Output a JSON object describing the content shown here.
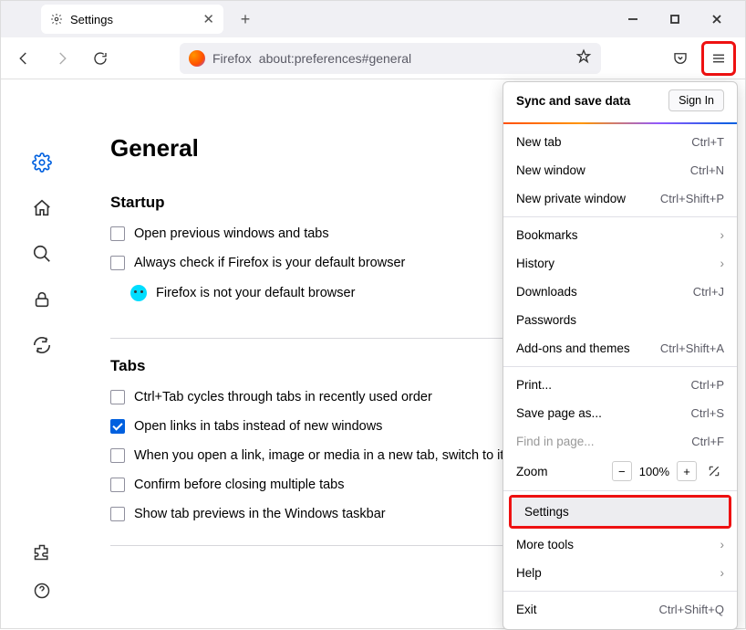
{
  "tab": {
    "title": "Settings"
  },
  "urlbar": {
    "name": "Firefox",
    "path": "about:preferences#general"
  },
  "page": {
    "heading": "General",
    "startup": {
      "title": "Startup",
      "open_previous": "Open previous windows and tabs",
      "always_check": "Always check if Firefox is your default browser",
      "not_default": "Firefox is not your default browser"
    },
    "tabs": {
      "title": "Tabs",
      "ctrl_tab": "Ctrl+Tab cycles through tabs in recently used order",
      "open_links": "Open links in tabs instead of new windows",
      "switch_new": "When you open a link, image or media in a new tab, switch to it immediately",
      "confirm_close": "Confirm before closing multiple tabs",
      "show_previews": "Show tab previews in the Windows taskbar"
    }
  },
  "menu": {
    "sync_header": "Sync and save data",
    "sign_in": "Sign In",
    "new_tab": {
      "label": "New tab",
      "shortcut": "Ctrl+T"
    },
    "new_window": {
      "label": "New window",
      "shortcut": "Ctrl+N"
    },
    "new_private": {
      "label": "New private window",
      "shortcut": "Ctrl+Shift+P"
    },
    "bookmarks": {
      "label": "Bookmarks"
    },
    "history": {
      "label": "History"
    },
    "downloads": {
      "label": "Downloads",
      "shortcut": "Ctrl+J"
    },
    "passwords": {
      "label": "Passwords"
    },
    "addons": {
      "label": "Add-ons and themes",
      "shortcut": "Ctrl+Shift+A"
    },
    "print": {
      "label": "Print...",
      "shortcut": "Ctrl+P"
    },
    "save_as": {
      "label": "Save page as...",
      "shortcut": "Ctrl+S"
    },
    "find": {
      "label": "Find in page...",
      "shortcut": "Ctrl+F"
    },
    "zoom": {
      "label": "Zoom",
      "value": "100%"
    },
    "settings": {
      "label": "Settings"
    },
    "more_tools": {
      "label": "More tools"
    },
    "help": {
      "label": "Help"
    },
    "exit": {
      "label": "Exit",
      "shortcut": "Ctrl+Shift+Q"
    }
  }
}
